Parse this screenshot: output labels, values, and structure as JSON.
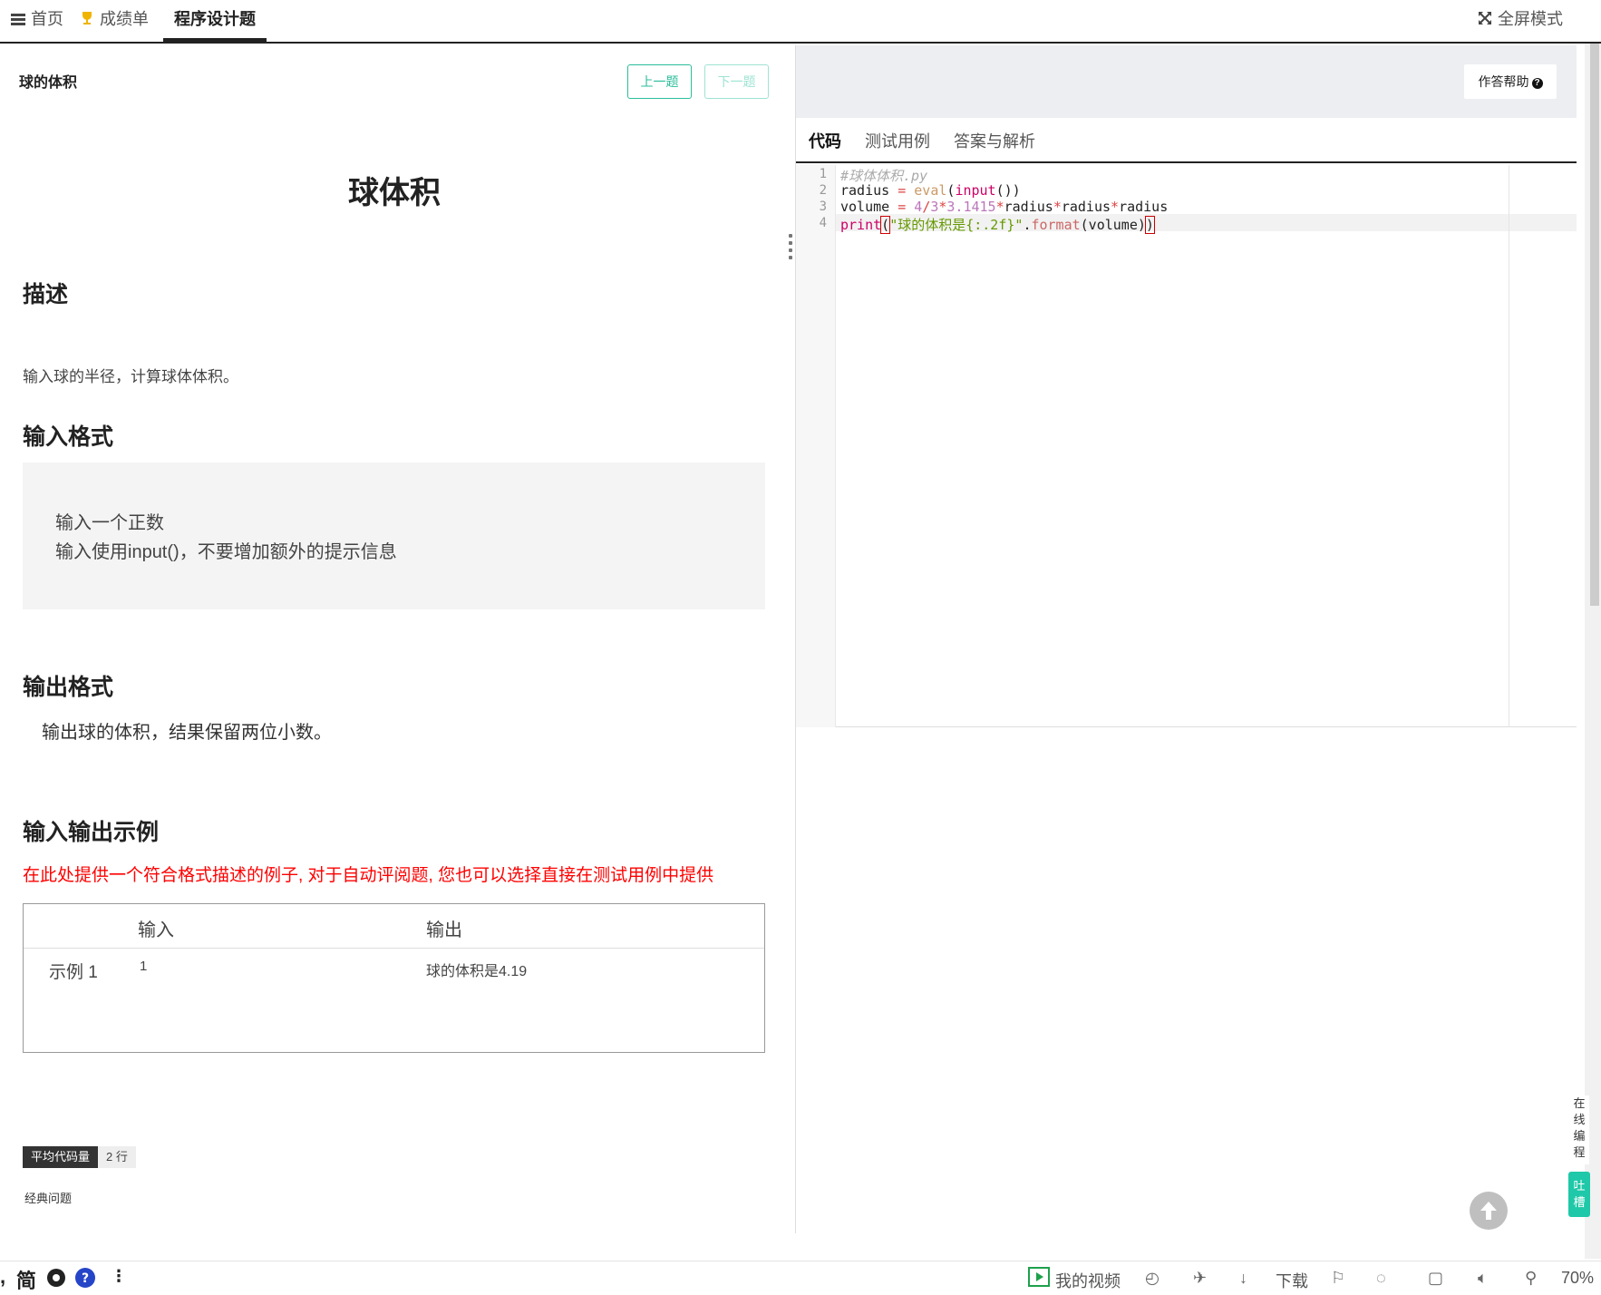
{
  "nav": {
    "home": "首页",
    "grades": "成绩单",
    "programming": "程序设计题",
    "fullscreen": "全屏模式"
  },
  "problem": {
    "small_title": "球的体积",
    "prev": "上一题",
    "next": "下一题",
    "big_title": "球体积",
    "desc_heading": "描述",
    "desc_text": "输入球的半径，计算球体体积。",
    "input_heading": "输入格式",
    "input_lines": [
      "输入一个正数",
      "输入使用input()，不要增加额外的提示信息"
    ],
    "output_heading": "输出格式",
    "output_text": "输出球的体积，结果保留两位小数。",
    "example_heading": "输入输出示例",
    "example_note": "在此处提供一个符合格式描述的例子, 对于自动评阅题, 您也可以选择直接在测试用例中提供",
    "table": {
      "col_input": "输入",
      "col_output": "输出",
      "row_label": "示例 1",
      "row_input": "1",
      "row_output": "球的体积是4.19"
    },
    "stat_label": "平均代码量",
    "stat_value": "2 行",
    "tag": "经典问题"
  },
  "editor": {
    "help": "作答帮助",
    "tabs": [
      "代码",
      "测试用例",
      "答案与解析"
    ],
    "line_numbers": [
      "1",
      "2",
      "3",
      "4"
    ],
    "code": [
      "#球体体积.py",
      "radius = eval(input())",
      "volume = 4/3*3.1415*radius*radius*radius",
      "print(\"球的体积是{:.2f}\".format(volume))"
    ]
  },
  "side": {
    "online_edit": "在线编程",
    "tucao": "吐槽"
  },
  "statusbar": {
    "left": "简",
    "my_video": "我的视频",
    "download": "下载",
    "zoom": "70%"
  },
  "colors": {
    "accent": "#2bbd9b",
    "warning_red": "#ff0000"
  }
}
